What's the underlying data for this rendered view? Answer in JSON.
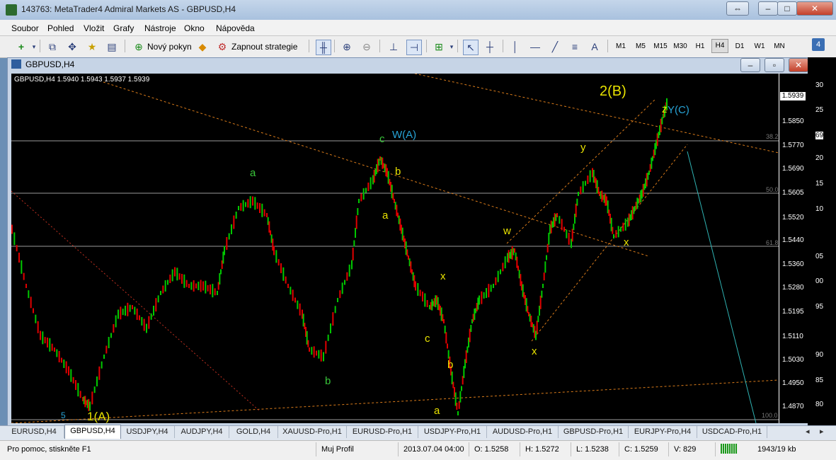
{
  "window": {
    "title": "143763: MetaTrader4 Admiral Markets AS - GBPUSD,H4"
  },
  "menu": [
    "Soubor",
    "Pohled",
    "Vložit",
    "Grafy",
    "Nástroje",
    "Okno",
    "Nápověda"
  ],
  "toolbar": {
    "new_order_label": "Nový pokyn",
    "strategies_label": "Zapnout strategie",
    "draw_text_label": "A",
    "timeframes": [
      "M1",
      "M5",
      "M15",
      "M30",
      "H1",
      "H4",
      "D1",
      "W1",
      "MN"
    ],
    "active_timeframe": "H4",
    "badge": "4"
  },
  "chart_window": {
    "title": "GBPUSD,H4"
  },
  "chart": {
    "info": "GBPUSD,H4  1.5940 1.5943 1.5937 1.5939",
    "current_price": "1.5939",
    "price_ticks": [
      "1.5850",
      "1.5770",
      "1.5690",
      "1.5605",
      "1.5520",
      "1.5440",
      "1.5360",
      "1.5280",
      "1.5195",
      "1.5110",
      "1.5030",
      "1.4950",
      "1.4870"
    ],
    "right_edge_ticks": [
      "30",
      "25",
      "69",
      "20",
      "15",
      "10",
      "05",
      "00",
      "95",
      "90",
      "85",
      "80"
    ],
    "fib_levels": [
      "38.2",
      "50.0",
      "61.8",
      "100.0"
    ],
    "wave_labels": {
      "a_green": "a",
      "b_green": "b",
      "c_teal": "c",
      "wa": "W(A)",
      "b_yellow": "b",
      "a_yellow": "a",
      "x_yellow_1": "x",
      "c_yellow": "c",
      "b_yellow_2": "b",
      "a_yellow_2": "a",
      "w_yellow": "w",
      "x_yellow_2": "x",
      "y_yellow": "y",
      "x_yellow_3": "x",
      "z_yellow": "z",
      "yc": "Y(C)",
      "two_b": "2(B)",
      "one_a": "1(A)",
      "five": "5"
    },
    "colors": {
      "bull": "#00c800",
      "bear": "#e00000",
      "teal": "#27a3d6",
      "yellow": "#e8e200",
      "green": "#39c63a",
      "trendline": "#d97b1a"
    }
  },
  "tabs": [
    "EURUSD,H4",
    "GBPUSD,H4",
    "USDJPY,H4",
    "AUDJPY,H4",
    "GOLD,H4",
    "XAUUSD-Pro,H1",
    "EURUSD-Pro,H1",
    "USDJPY-Pro,H1",
    "AUDUSD-Pro,H1",
    "GBPUSD-Pro,H1",
    "EURJPY-Pro,H4",
    "USDCAD-Pro,H1"
  ],
  "active_tab": "GBPUSD,H4",
  "status": {
    "help": "Pro pomoc, stiskněte F1",
    "profile": "Muj Profil",
    "datetime": "2013.07.04 04:00",
    "open": "O: 1.5258",
    "high": "H: 1.5272",
    "low": "L: 1.5238",
    "close": "C: 1.5259",
    "volume": "V: 829",
    "traffic": "1943/19 kb"
  }
}
